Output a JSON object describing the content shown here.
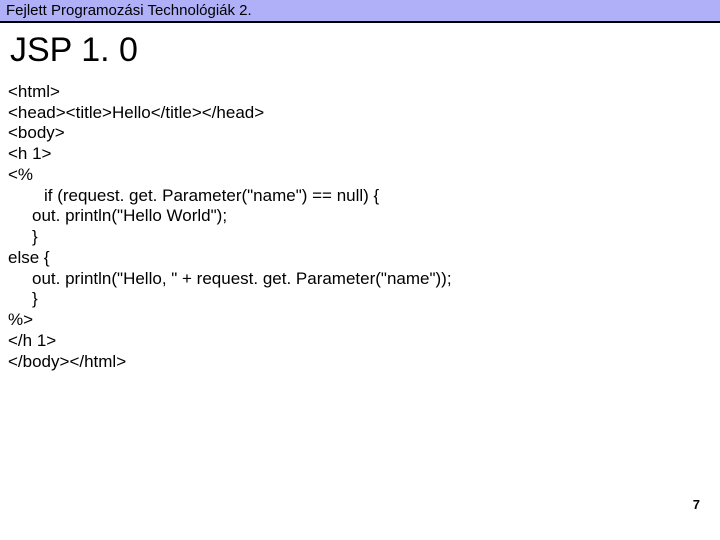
{
  "header": {
    "course_title": "Fejlett Programozási Technológiák 2."
  },
  "slide": {
    "title": "JSP 1. 0",
    "page_number": "7"
  },
  "code": {
    "l1": "<html>",
    "l2": "<head><title>Hello</title></head>",
    "l3": "<body>",
    "l4": "<h 1>",
    "l5": "<%",
    "l6": "if (request. get. Parameter(\"name\") == null) {",
    "l7": "out. println(\"Hello World\");",
    "l8": "}",
    "l9": "else {",
    "l10": "out. println(\"Hello, \" + request. get. Parameter(\"name\"));",
    "l11": "}",
    "l12": "%>",
    "l13": "</h 1>",
    "l14": "</body></html>"
  }
}
